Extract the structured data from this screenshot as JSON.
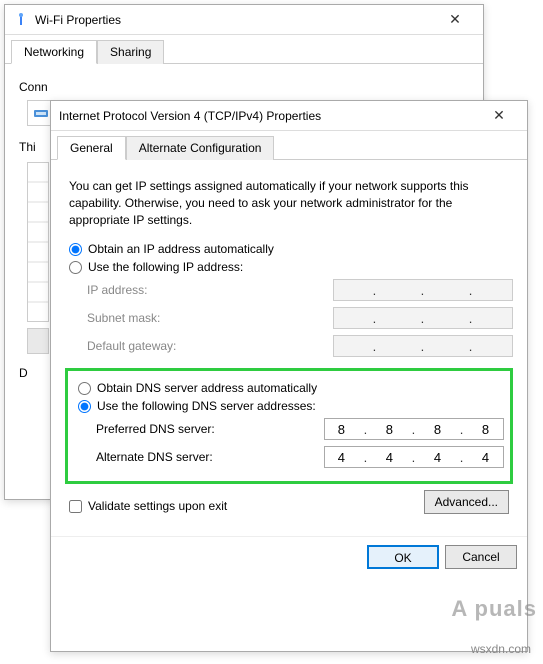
{
  "wifi_window": {
    "title": "Wi-Fi Properties",
    "tabs": [
      "Networking",
      "Sharing"
    ],
    "conn_label_fragment": "Conn",
    "th_label_fragment": "Thi",
    "d_label_fragment": "D"
  },
  "ipv4_window": {
    "title": "Internet Protocol Version 4 (TCP/IPv4) Properties",
    "tabs": [
      "General",
      "Alternate Configuration"
    ],
    "description": "You can get IP settings assigned automatically if your network supports this capability. Otherwise, you need to ask your network administrator for the appropriate IP settings.",
    "ip": {
      "auto_label": "Obtain an IP address automatically",
      "manual_label": "Use the following IP address:",
      "ip_label": "IP address:",
      "subnet_label": "Subnet mask:",
      "gateway_label": "Default gateway:",
      "auto_selected": true
    },
    "dns": {
      "auto_label": "Obtain DNS server address automatically",
      "manual_label": "Use the following DNS server addresses:",
      "preferred_label": "Preferred DNS server:",
      "alternate_label": "Alternate DNS server:",
      "manual_selected": true,
      "preferred": [
        "8",
        "8",
        "8",
        "8"
      ],
      "alternate": [
        "4",
        "4",
        "4",
        "4"
      ]
    },
    "validate_label": "Validate settings upon exit",
    "advanced_label": "Advanced...",
    "ok_label": "OK",
    "cancel_label": "Cancel"
  },
  "watermark": "A puals",
  "footer": "wsxdn.com"
}
